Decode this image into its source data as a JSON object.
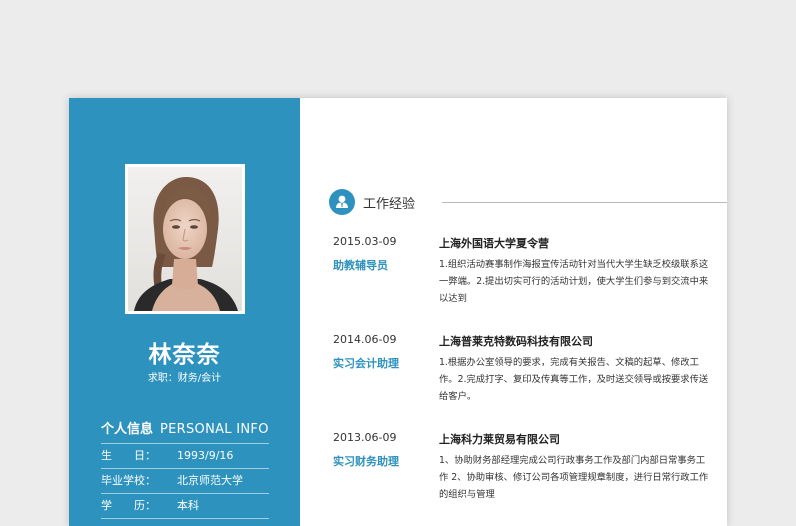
{
  "profile": {
    "name": "林奈奈",
    "objective": "求职：财务/会计"
  },
  "personal_info": {
    "title_cn": "个人信息",
    "title_en": "PERSONAL INFO",
    "rows": [
      {
        "label": "生　　日：",
        "value": "1993/9/16"
      },
      {
        "label": "毕业学校：",
        "value": "北京师范大学"
      },
      {
        "label": "学　　历：",
        "value": "本科"
      }
    ]
  },
  "work": {
    "section_title": "工作经验",
    "jobs": [
      {
        "date": "2015.03-09",
        "role": "助教辅导员",
        "company": "上海外国语大学夏令营",
        "description": "1.组织活动赛事制作海报宣传活动针对当代大学生缺乏校级联系这一弊端。2.提出切实可行的活动计划，使大学生们参与到交流中来以达到"
      },
      {
        "date": "2014.06-09",
        "role": "实习会计助理",
        "company": "上海普莱克特数码科技有限公司",
        "description": "1.根据办公室领导的要求，完成有关报告、文稿的起草、修改工作。2.完成打字、复印及传真等工作，及时送交领导或按要求传送给客户。"
      },
      {
        "date": "2013.06-09",
        "role": "实习财务助理",
        "company": "上海科力莱贸易有限公司",
        "description": "1、协助财务部经理完成公司行政事务工作及部门内部日常事务工作 2、协助审核、修订公司各项管理规章制度，进行日常行政工作的组织与管理"
      }
    ]
  },
  "colors": {
    "accent": "#2d92bd",
    "background": "#ececec",
    "sheet": "#ffffff"
  },
  "icons": {
    "section": "user-icon"
  }
}
